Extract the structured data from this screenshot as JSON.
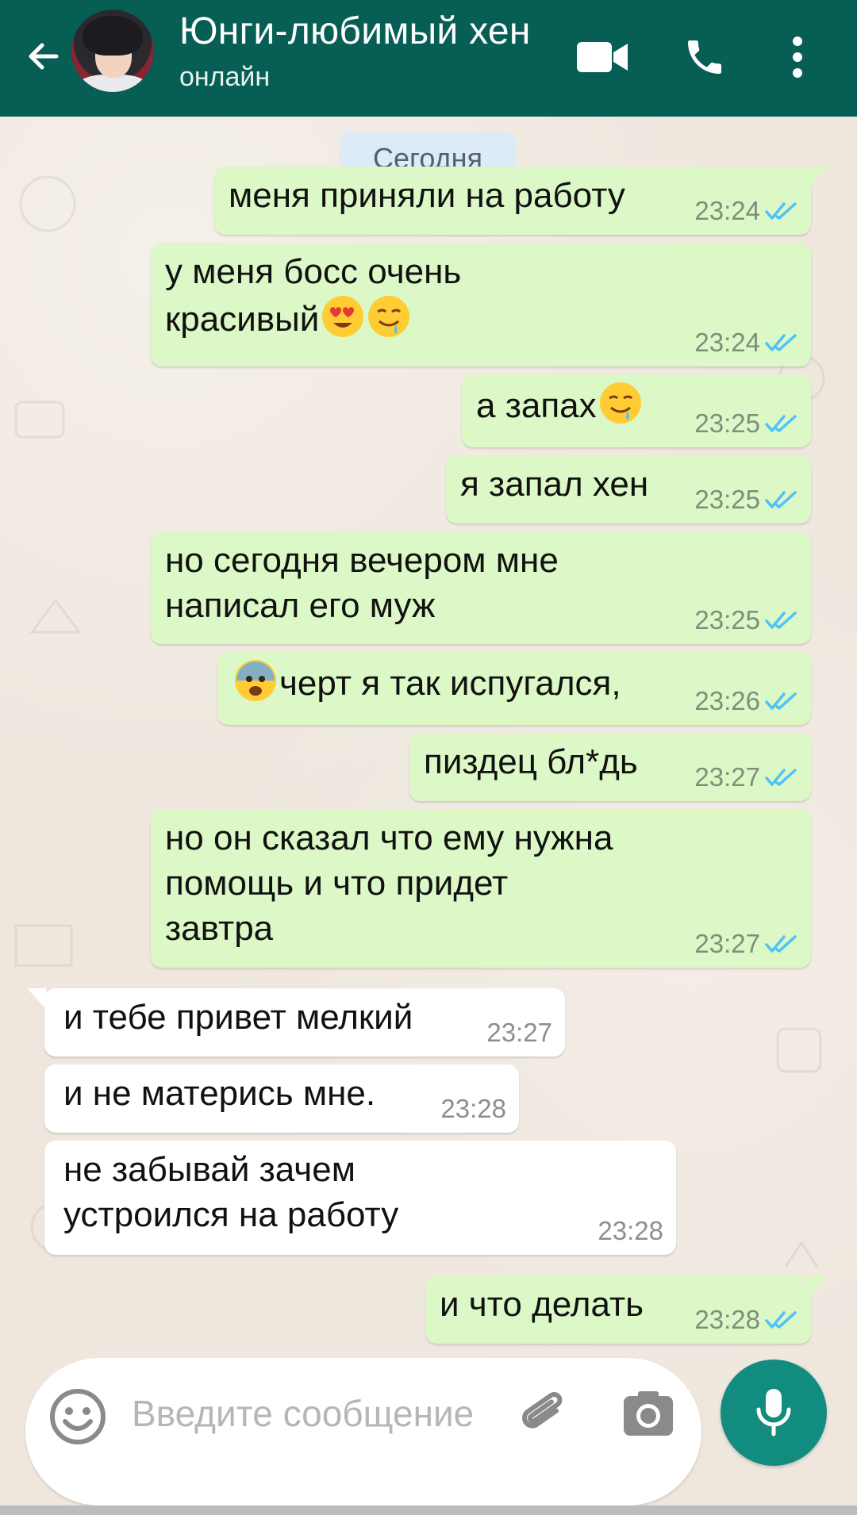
{
  "header": {
    "contact_name": "Юнги-любимый хен",
    "status": "онлайн",
    "bg_color": "#075E54",
    "icons": [
      "back-arrow-icon",
      "video-call-icon",
      "phone-icon",
      "more-vert-icon"
    ]
  },
  "date_chip": "Сегодня",
  "messages": [
    {
      "dir": "out",
      "text": "меня приняли на работу",
      "time": "23:24",
      "status": "read"
    },
    {
      "dir": "out",
      "lines": [
        "у меня босс очень",
        "красивый"
      ],
      "emojis": [
        "heart-eyes-emoji",
        "drooling-face-emoji"
      ],
      "time": "23:24",
      "status": "read"
    },
    {
      "dir": "out",
      "text": "а запах",
      "emojis": [
        "drooling-face-emoji"
      ],
      "time": "23:25",
      "status": "read"
    },
    {
      "dir": "out",
      "text": "я запал хен",
      "time": "23:25",
      "status": "read"
    },
    {
      "dir": "out",
      "lines": [
        "но сегодня вечером мне",
        "написал его муж"
      ],
      "time": "23:25",
      "status": "read"
    },
    {
      "dir": "out",
      "text": "черт я так испугался,",
      "emojis": [
        "fearful-face-emoji"
      ],
      "time": "23:26",
      "status": "read"
    },
    {
      "dir": "out",
      "text": "пиздец бл*дь",
      "time": "23:27",
      "status": "read"
    },
    {
      "dir": "out",
      "lines": [
        "но он сказал что ему нужна",
        "помощь и что придет",
        "завтра"
      ],
      "time": "23:27",
      "status": "read"
    },
    {
      "dir": "in",
      "text": "и тебе привет мелкий",
      "time": "23:27"
    },
    {
      "dir": "in",
      "text": "и не матерись мне.",
      "time": "23:28"
    },
    {
      "dir": "in",
      "lines": [
        "не забывай зачем",
        "устроился на работу"
      ],
      "time": "23:28"
    },
    {
      "dir": "out",
      "text": "и что делать",
      "time": "23:28",
      "status": "read"
    }
  ],
  "composer": {
    "placeholder": "Введите сообщение",
    "icons": [
      "emoji-icon",
      "attach-icon",
      "camera-icon",
      "mic-icon"
    ],
    "send_color": "#128C7E"
  },
  "colors": {
    "outgoing_bubble": "#DCF8C6",
    "incoming_bubble": "#FFFFFF",
    "read_ticks": "#4FC3F7"
  }
}
